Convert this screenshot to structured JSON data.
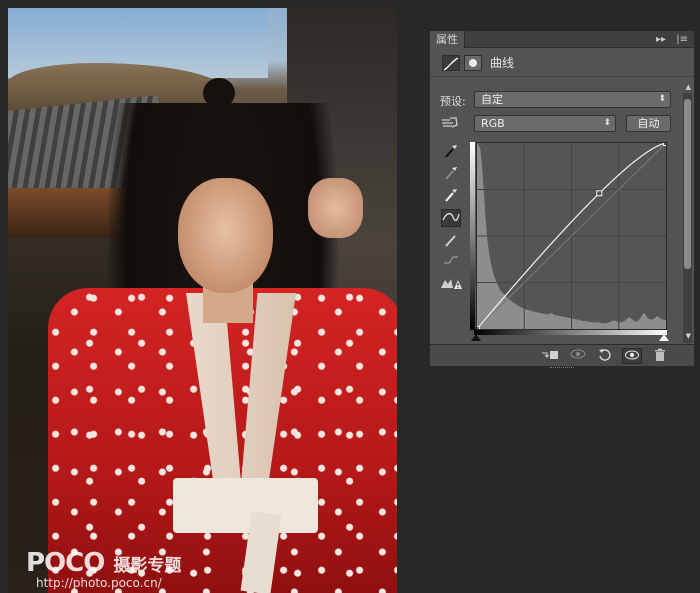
{
  "photo": {
    "watermark_logo": "POCO",
    "watermark_sub": "摄影专题",
    "watermark_url": "http://photo.poco.cn/"
  },
  "panel": {
    "tab_label": "属性",
    "collapse_glyph": "▸▸",
    "menu_glyph": "|≡",
    "title": "曲线",
    "preset_label": "预设:",
    "preset_value": "自定",
    "channel_value": "RGB",
    "auto_label": "自动",
    "tool_icons": [
      "hand-target-icon",
      "black-point-eyedropper-icon",
      "gray-point-eyedropper-icon",
      "white-point-eyedropper-icon",
      "curve-edit-icon",
      "pencil-icon",
      "smooth-icon",
      "clipping-warning-icon"
    ],
    "footer_icons": [
      "clip-to-layer-icon",
      "view-previous-icon",
      "reset-icon",
      "visibility-icon",
      "delete-icon"
    ]
  },
  "colors": {
    "panel_bg": "#535353",
    "app_bg": "#282828",
    "dress_red": "#c41c1c"
  },
  "curve": {
    "points": [
      [
        0,
        0
      ],
      [
        165,
        186
      ],
      [
        255,
        255
      ]
    ],
    "histogram": [
      255,
      252,
      246,
      222,
      186,
      150,
      122,
      104,
      90,
      80,
      72,
      66,
      60,
      55,
      52,
      49,
      47,
      44,
      42,
      40,
      38,
      36,
      35,
      33,
      32,
      30,
      29,
      28,
      27,
      26,
      26,
      25,
      24,
      24,
      23,
      23,
      22,
      22,
      21,
      21,
      20,
      20,
      21,
      22,
      20,
      19,
      19,
      18,
      18,
      17,
      17,
      16,
      16,
      15,
      15,
      14,
      14,
      13,
      13,
      12,
      12,
      11,
      11,
      11,
      10,
      10,
      10,
      9,
      9,
      9,
      9,
      9,
      8,
      8,
      8,
      8,
      9,
      10,
      11,
      12,
      11,
      10,
      9,
      9,
      10,
      11,
      13,
      15,
      16,
      14,
      12,
      11,
      10,
      12,
      14,
      18,
      22,
      20,
      16,
      14,
      13,
      13,
      14,
      16,
      18,
      16,
      14,
      13,
      13,
      12
    ]
  }
}
